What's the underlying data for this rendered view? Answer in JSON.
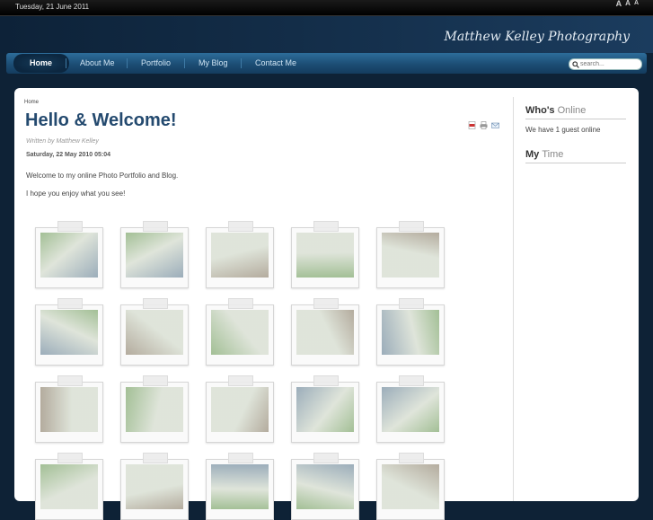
{
  "topbar": {
    "date": "Tuesday, 21 June 2011",
    "font_size_controls": [
      "A",
      "A",
      "A"
    ]
  },
  "header": {
    "site_title": "Matthew Kelley Photography"
  },
  "nav": {
    "items": [
      {
        "label": "Home",
        "active": true
      },
      {
        "label": "About Me"
      },
      {
        "label": "Portfolio"
      },
      {
        "label": "My Blog"
      },
      {
        "label": "Contact Me"
      }
    ]
  },
  "search": {
    "placeholder": "search..."
  },
  "article": {
    "breadcrumb": "Home",
    "title": "Hello & Welcome!",
    "author": "Written by Matthew Kelley",
    "created": "Saturday, 22 May 2010 05:04",
    "paragraphs": [
      "Welcome to my online Photo Portfolio and Blog.",
      "I hope you enjoy what you see!"
    ],
    "action_icons": [
      "pdf-icon",
      "print-icon",
      "email-icon"
    ]
  },
  "gallery": {
    "photos": [
      {
        "subject": "heron"
      },
      {
        "subject": "heron"
      },
      {
        "subject": "tree"
      },
      {
        "subject": "enclosure"
      },
      {
        "subject": "leopard"
      },
      {
        "subject": "deer-herd"
      },
      {
        "subject": "animal"
      },
      {
        "subject": "animal"
      },
      {
        "subject": "gibbon"
      },
      {
        "subject": "animal"
      },
      {
        "subject": "zebra"
      },
      {
        "subject": "tiger"
      },
      {
        "subject": "bird"
      },
      {
        "subject": "animal"
      },
      {
        "subject": "antelope"
      },
      {
        "subject": "animal"
      },
      {
        "subject": "animal"
      },
      {
        "subject": "animal"
      },
      {
        "subject": "animal"
      },
      {
        "subject": "animal"
      }
    ],
    "colors": {
      "foliage": "#5b8f43",
      "earth": "#7a6b52",
      "sky": "#c9d3c0",
      "water": "#4e6e86"
    }
  },
  "sidebar": {
    "whos_online": {
      "title_bold": "Who's",
      "title_light": "Online",
      "text": "We have 1 guest online"
    },
    "my_time": {
      "title_bold": "My",
      "title_light": "Time"
    }
  },
  "colors": {
    "background": "#0e2236",
    "nav": "#1c4d74",
    "title": "#244a6f"
  }
}
